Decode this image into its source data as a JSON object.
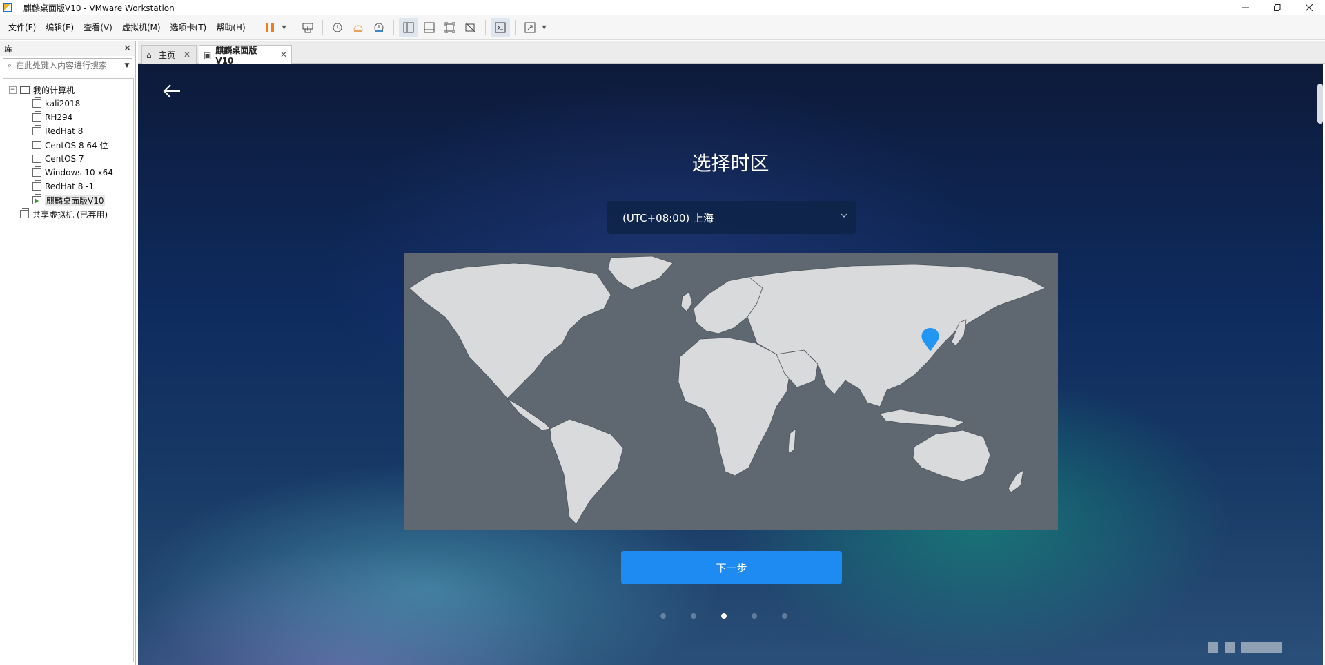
{
  "window": {
    "title": "麒麟桌面版V10 - VMware Workstation"
  },
  "menu": [
    "文件(F)",
    "编辑(E)",
    "查看(V)",
    "虚拟机(M)",
    "选项卡(T)",
    "帮助(H)"
  ],
  "library": {
    "title": "库",
    "search_placeholder": "在此处键入内容进行搜索",
    "root": "我的计算机",
    "vms": [
      "kali2018",
      "RH294",
      "RedHat 8",
      "CentOS 8 64 位",
      "CentOS 7",
      "Windows 10 x64",
      "RedHat 8 -1",
      "麒麟桌面版V10"
    ],
    "shared": "共享虚拟机 (已弃用)"
  },
  "tabs": [
    {
      "label": "主页"
    },
    {
      "label": "麒麟桌面版V10"
    }
  ],
  "vm_screen": {
    "heading": "选择时区",
    "timezone_value": "(UTC+08:00) 上海",
    "next_label": "下一步",
    "page_dots": 5,
    "active_dot": 3,
    "accent_color": "#1e8bf2",
    "map_pin_color": "#2196f3"
  }
}
